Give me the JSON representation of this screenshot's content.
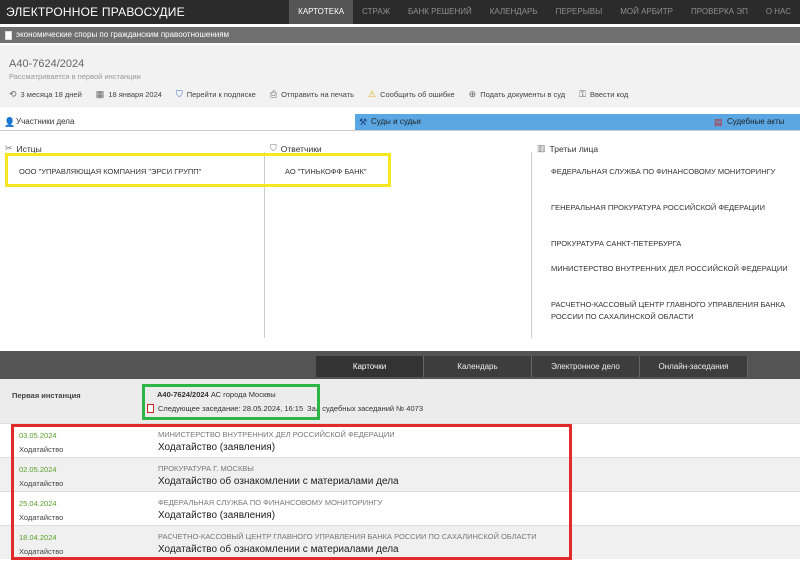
{
  "app": {
    "brand": "ЭЛЕКТРОННОЕ ПРАВОСУДИЕ",
    "nav": [
      "КАРТОТЕКА",
      "СТРАЖ",
      "БАНК РЕШЕНИЙ",
      "КАЛЕНДАРЬ",
      "ПЕРЕРЫВЫ",
      "МОЙ АРБИТР",
      "ПРОВЕРКА ЭП",
      "О НАС"
    ],
    "active_nav": "КАРТОТЕКА"
  },
  "category": "экономические споры по гражданским правоотношениям",
  "case": {
    "number": "А40-7624/2024",
    "status": "Рассматривается в первой инстанции",
    "toolbar": [
      {
        "icon": "clock-icon",
        "label": "3 месяца 18 дней"
      },
      {
        "icon": "calendar-icon",
        "label": "18 января 2024"
      },
      {
        "icon": "shield-icon",
        "label": "Перейти к подписке"
      },
      {
        "icon": "printer-icon",
        "label": "Отправить на печать"
      },
      {
        "icon": "warning-icon",
        "label": "Сообщить об ошибке"
      },
      {
        "icon": "plus-circle-icon",
        "label": "Подать документы в суд"
      },
      {
        "icon": "key-icon",
        "label": "Ввести код"
      }
    ]
  },
  "tabs": {
    "participants": "Участники дела",
    "courts": "Суды и судьи",
    "acts": "Судебные акты"
  },
  "participants": {
    "plaintiffs_title": "Истцы",
    "defendants_title": "Ответчики",
    "third_title": "Третьи лица",
    "plaintiff": "ООО \"УПРАВЛЯЮЩАЯ КОМПАНИЯ \"ЭРСИ ГРУПП\"",
    "defendant": "АО \"ТИНЬКОФФ БАНК\"",
    "third_parties": [
      "ФЕДЕРАЛЬНАЯ СЛУЖБА ПО ФИНАНСОВОМУ МОНИТОРИНГУ",
      "ГЕНЕРАЛЬНАЯ ПРОКУРАТУРА РОССИЙСКОЙ ФЕДЕРАЦИИ",
      "ПРОКУРАТУРА САНКТ-ПЕТЕРБУРГА",
      "МИНИСТЕРСТВО ВНУТРЕННИХ ДЕЛ РОССИЙСКОЙ ФЕДЕРАЦИИ",
      "РАСЧЕТНО-КАССОВЫЙ ЦЕНТР ГЛАВНОГО УПРАВЛЕНИЯ БАНКА РОССИИ ПО САХАЛИНСКОЙ ОБЛАСТИ"
    ]
  },
  "bottom_tabs": [
    "Карточки",
    "Календарь",
    "Электронное дело",
    "Онлайн-заседания"
  ],
  "instance": {
    "label": "Первая инстанция",
    "case_number": "А40-7624/2024",
    "court": "АС города Москвы",
    "next_session": "Следующее заседание: 28.05.2024, 16:15",
    "hall": "Зал судебных заседаний № 4073"
  },
  "documents": [
    {
      "date": "03.05.2024",
      "kind": "Ходатайство",
      "org": "МИНИСТЕРСТВО ВНУТРЕННИХ ДЕЛ РОССИЙСКОЙ ФЕДЕРАЦИИ",
      "title": "Ходатайство (заявления)"
    },
    {
      "date": "02.05.2024",
      "kind": "Ходатайство",
      "org": "ПРОКУРАТУРА Г. МОСКВЫ",
      "title": "Ходатайство об ознакомлении с материалами дела"
    },
    {
      "date": "25.04.2024",
      "kind": "Ходатайство",
      "org": "ФЕДЕРАЛЬНАЯ СЛУЖБА ПО ФИНАНСОВОМУ МОНИТОРИНГУ",
      "title": "Ходатайство (заявления)"
    },
    {
      "date": "18.04.2024",
      "kind": "Ходатайство",
      "org": "РАСЧЕТНО-КАССОВЫЙ ЦЕНТР ГЛАВНОГО УПРАВЛЕНИЯ БАНКА РОССИИ ПО САХАЛИНСКОЙ ОБЛАСТИ",
      "title": "Ходатайство об ознакомлении с материалами дела"
    }
  ],
  "highlight_colors": {
    "yellow": "#f5e821",
    "green": "#2fb545",
    "red": "#e32a2a"
  }
}
